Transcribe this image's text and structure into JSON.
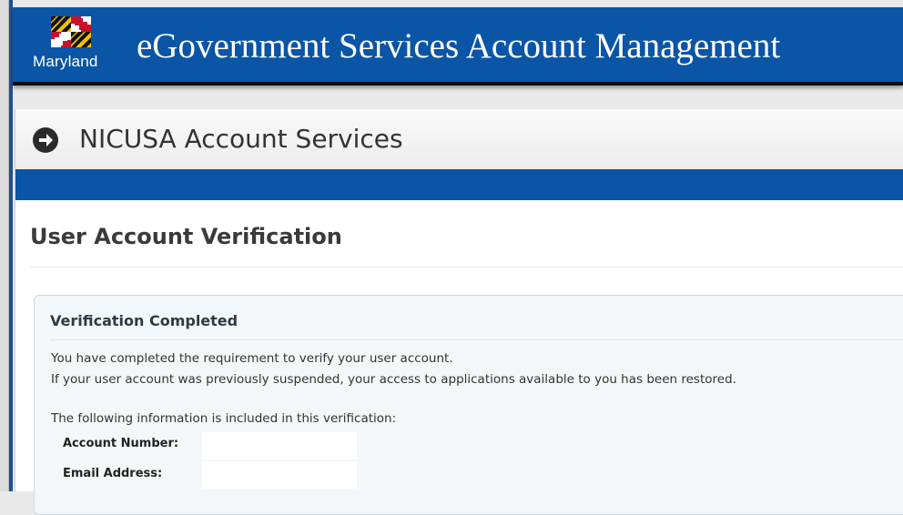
{
  "banner": {
    "logo_text": "Maryland",
    "title": "eGovernment Services Account Management",
    "color": "#0a55a6"
  },
  "service_header": {
    "icon": "arrow-circle-right-icon",
    "title": "NICUSA Account Services"
  },
  "page": {
    "title": "User Account Verification"
  },
  "verification": {
    "heading": "Verification Completed",
    "line1": "You have completed the requirement to verify your user account.",
    "line2": "If your user account was previously suspended, your access to applications available to you has been restored.",
    "info_intro": "The following information is included in this verification:",
    "fields": [
      {
        "label": "Account Number:",
        "value": ""
      },
      {
        "label": "Email Address:",
        "value": ""
      }
    ]
  }
}
